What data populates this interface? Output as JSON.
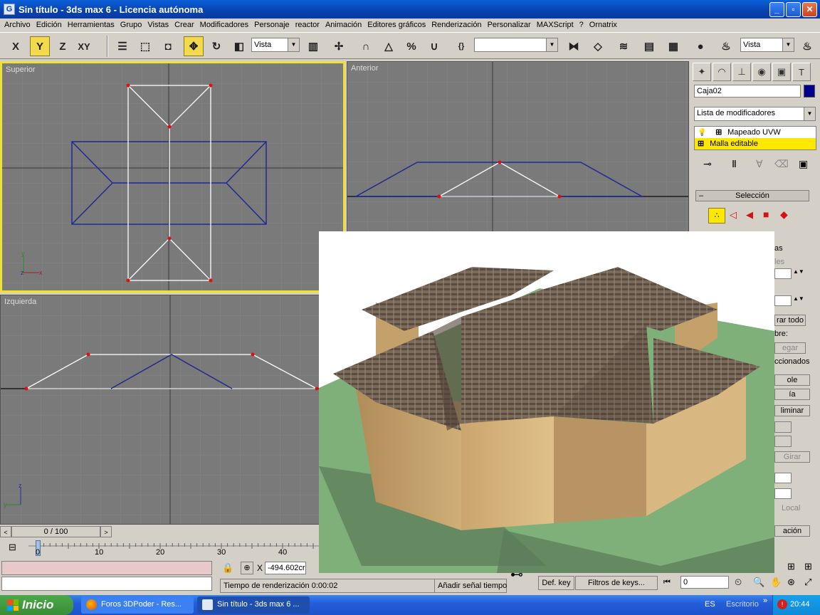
{
  "window": {
    "title": "Sin título - 3ds max 6 - Licencia autónoma",
    "app_icon": "G",
    "buttons": {
      "minimize": "_",
      "maximize": "▫",
      "close": "✕"
    }
  },
  "menu": [
    "Archivo",
    "Edición",
    "Herramientas",
    "Grupo",
    "Vistas",
    "Crear",
    "Modificadores",
    "Personaje",
    "reactor",
    "Animación",
    "Editores gráficos",
    "Renderización",
    "Personalizar",
    "MAXScript",
    "?",
    "Ornatrix"
  ],
  "toolbar": {
    "axis_x": "X",
    "axis_y": "Y",
    "axis_z": "Z",
    "axis_xy": "XY",
    "reference_coord": "Vista",
    "named_selection": "",
    "render_view": "Vista"
  },
  "viewports": {
    "top": "Superior",
    "front": "Anterior",
    "left": "Izquierda"
  },
  "axis_letters": {
    "x": "x",
    "y": "y",
    "z": "z"
  },
  "command_panel": {
    "object_name": "Caja02",
    "object_color": "#00008b",
    "modifier_list": "Lista de modificadores",
    "modifiers": [
      "Mapeado UVW",
      "Malla editable"
    ],
    "selection_rollout": "Selección",
    "fragments": [
      "as",
      "les",
      "rar todo",
      "bre:",
      "egar",
      "ccionados",
      "ole",
      "ía",
      "liminar",
      "Girar",
      "Local",
      "ación"
    ]
  },
  "timeline": {
    "frame": "0 / 100",
    "ticks": [
      "0",
      "10",
      "20",
      "30",
      "40"
    ],
    "tick_values": [
      0,
      10,
      20,
      30,
      40
    ]
  },
  "status": {
    "coord_label": "X",
    "x_value": "-494.602cr",
    "render_time": "Tiempo de renderización  0:00:02",
    "add_time_tag": "Añadir señal tiempo",
    "set_key": "Def. key",
    "key_filters": "Filtros de keys...",
    "frame_field": "0"
  },
  "taskbar": {
    "start": "Inicio",
    "tasks": [
      "Foros 3DPoder - Res...",
      "Sin título - 3ds max 6 ..."
    ],
    "desktop": "Escritorio",
    "lang": "ES",
    "time": "20:44"
  }
}
